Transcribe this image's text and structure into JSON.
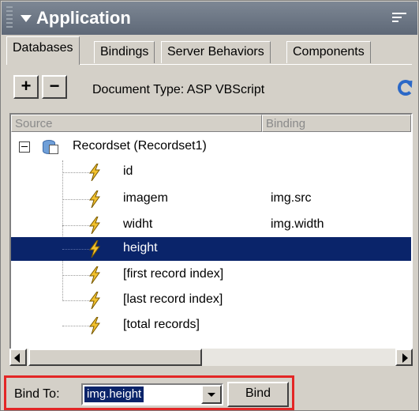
{
  "panel": {
    "title": "Application",
    "tabs": [
      "Databases",
      "Bindings",
      "Server Behaviors",
      "Components"
    ],
    "active_tab": "Bindings"
  },
  "toolbar": {
    "add_label": "+",
    "remove_label": "−",
    "doc_type": "Document Type: ASP VBScript"
  },
  "columns": {
    "source": "Source",
    "binding": "Binding"
  },
  "recordset": {
    "label": "Recordset (Recordset1)",
    "fields": [
      {
        "name": "id",
        "binding": ""
      },
      {
        "name": "imagem",
        "binding": "img.src"
      },
      {
        "name": "widht",
        "binding": "img.width"
      },
      {
        "name": "height",
        "binding": "",
        "selected": true
      },
      {
        "name": "[first record index]",
        "binding": ""
      },
      {
        "name": "[last record index]",
        "binding": ""
      },
      {
        "name": "[total records]",
        "binding": ""
      }
    ]
  },
  "bind_bar": {
    "label": "Bind To:",
    "selected_value": "img.height",
    "button_label": "Bind"
  },
  "colors": {
    "selection": "#0a246a",
    "highlight_border": "#e32626",
    "panel_bg": "#d4d0c8"
  }
}
